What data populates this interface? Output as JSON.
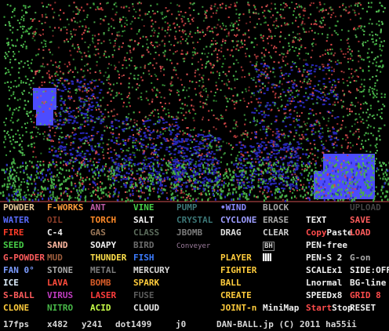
{
  "palette": {
    "rows": [
      [
        {
          "text": "POWDER",
          "color": "#e8c898"
        },
        {
          "text": "F-WORKS",
          "color": "#ff9c3c"
        },
        {
          "text": "ANT",
          "color": "#c05ca8"
        },
        {
          "text": "VINE",
          "color": "#48d048"
        },
        {
          "text": "PUMP",
          "color": "#3c7878"
        },
        {
          "text": "WIND",
          "color": "#8888ff",
          "dot": true
        },
        {
          "text": "BLOCK",
          "color": "#a8a8a8"
        },
        {
          "text": "",
          "color": "#000"
        },
        {
          "text": "UPLOAD",
          "color": "#444444"
        }
      ],
      [
        {
          "text": "WATER",
          "color": "#5a6cff"
        },
        {
          "text": "OIL",
          "color": "#8a3c28"
        },
        {
          "text": "TORCH",
          "color": "#ff8a28"
        },
        {
          "text": "SALT",
          "color": "#f0f0f0"
        },
        {
          "text": "CRYSTAL",
          "color": "#3c7878"
        },
        {
          "text": "CYCLONE",
          "color": "#9c9cff"
        },
        {
          "text": "ERASE",
          "color": "#a8a8a8"
        },
        {
          "text": "TEXT",
          "color": "#f0f0f0"
        },
        {
          "text": "SAVE",
          "color": "#ff5c5c"
        }
      ],
      [
        {
          "text": "FIRE",
          "color": "#ff3c28"
        },
        {
          "text": "C-4",
          "color": "#f0f0f0"
        },
        {
          "text": "GAS",
          "color": "#9c7858"
        },
        {
          "text": "CLASS",
          "color": "#5c6c5c"
        },
        {
          "text": "JBOMB",
          "color": "#7c7c7c"
        },
        {
          "text": "DRAG",
          "color": "#e0e0e0"
        },
        {
          "text": "CLEAR",
          "color": "#d0d0d0"
        },
        {
          "text": "Copy",
          "color": "#ff4c4c",
          "text2": "Paste",
          "color2": "#f0f0f0"
        },
        {
          "text": "LOAD",
          "color": "#ff5c5c"
        }
      ],
      [
        {
          "text": "SEED",
          "color": "#48d048"
        },
        {
          "text": "SAND",
          "color": "#ffb8a0"
        },
        {
          "text": "SOAPY",
          "color": "#f0f0f0"
        },
        {
          "text": "BIRD",
          "color": "#6c6c6c"
        },
        {
          "text": "Conveyer",
          "color": "#9c7c9c",
          "small": true
        },
        {
          "text": "",
          "color": "#000"
        },
        {
          "text": "BH",
          "color": "#d0d0d0",
          "boxed": true
        },
        {
          "text": "PEN-free",
          "color": "#f0f0f0"
        },
        {
          "text": "",
          "color": "#000"
        }
      ],
      [
        {
          "text": "G-POWDER",
          "color": "#ff5c5c"
        },
        {
          "text": "MUD",
          "color": "#9c5c3c"
        },
        {
          "text": "THUNDER",
          "color": "#ffe04c"
        },
        {
          "text": "FISH",
          "color": "#3c7cff"
        },
        {
          "text": "",
          "color": "#000"
        },
        {
          "text": "PLAYER",
          "color": "#ffcc3c"
        },
        {
          "text": "",
          "color": "#000",
          "chip": true
        },
        {
          "text": "PEN-S 2",
          "color": "#f0f0f0"
        },
        {
          "text": "G-on",
          "color": "#aaaaaa"
        }
      ],
      [
        {
          "text": "FAN 0°",
          "color": "#7c9cff"
        },
        {
          "text": "STONE",
          "color": "#a8a8a8"
        },
        {
          "text": "METAL",
          "color": "#7c7c7c"
        },
        {
          "text": "MERCURY",
          "color": "#d8d8d8"
        },
        {
          "text": "",
          "color": "#000"
        },
        {
          "text": "FIGHTER",
          "color": "#ffcc3c"
        },
        {
          "text": "",
          "color": "#000"
        },
        {
          "text": "SCALEx1",
          "color": "#f0f0f0"
        },
        {
          "text": "SIDE:OFF",
          "color": "#f0f0f0"
        }
      ],
      [
        {
          "text": "ICE",
          "color": "#e0f0ff"
        },
        {
          "text": "LAVA",
          "color": "#ff4c3c"
        },
        {
          "text": "BOMB",
          "color": "#d85c28"
        },
        {
          "text": "SPARK",
          "color": "#ffcc3c"
        },
        {
          "text": "",
          "color": "#000"
        },
        {
          "text": "BALL",
          "color": "#ffcc3c"
        },
        {
          "text": "",
          "color": "#000"
        },
        {
          "text": "Lnormal",
          "color": "#f0f0f0"
        },
        {
          "text": "BG-line",
          "color": "#f0f0f0"
        }
      ],
      [
        {
          "text": "S-BALL",
          "color": "#ff5c5c"
        },
        {
          "text": "VIRUS",
          "color": "#c03cc0"
        },
        {
          "text": "LASER",
          "color": "#ff3c3c"
        },
        {
          "text": "FUSE",
          "color": "#5c5c5c"
        },
        {
          "text": "",
          "color": "#000"
        },
        {
          "text": "CREATE",
          "color": "#ffcc3c"
        },
        {
          "text": "",
          "color": "#000"
        },
        {
          "text": "SPEEDx8",
          "color": "#f0f0f0"
        },
        {
          "text": "GRID 8",
          "color": "#ff4c4c"
        }
      ],
      [
        {
          "text": "CLONE",
          "color": "#ffcc3c"
        },
        {
          "text": "NITRO",
          "color": "#48b848"
        },
        {
          "text": "ACID",
          "color": "#c8ff48"
        },
        {
          "text": "CLOUD",
          "color": "#e8e8e8"
        },
        {
          "text": "",
          "color": "#000"
        },
        {
          "text": "JOINT-n",
          "color": "#ffcc3c"
        },
        {
          "text": "MiniMap",
          "color": "#f0f0f0"
        },
        {
          "text": "Start",
          "color": "#ff4c4c",
          "text2": "Stop",
          "color2": "#f0f0f0"
        },
        {
          "text": "RESET",
          "color": "#f0f0f0"
        }
      ]
    ]
  },
  "status": {
    "fps": "17fps",
    "x": "x482",
    "y": "y241",
    "dots": "dot1499",
    "j": "j0",
    "credit": "DAN-BALL.jp (C) 2011 ha55ii"
  },
  "scene": {
    "background": "#000000",
    "foliage_colors": [
      "#d84848",
      "#c03c3c",
      "#48b048",
      "#38a038",
      "#2c2cc0",
      "#4848ff"
    ],
    "border_color": "#d05050"
  }
}
